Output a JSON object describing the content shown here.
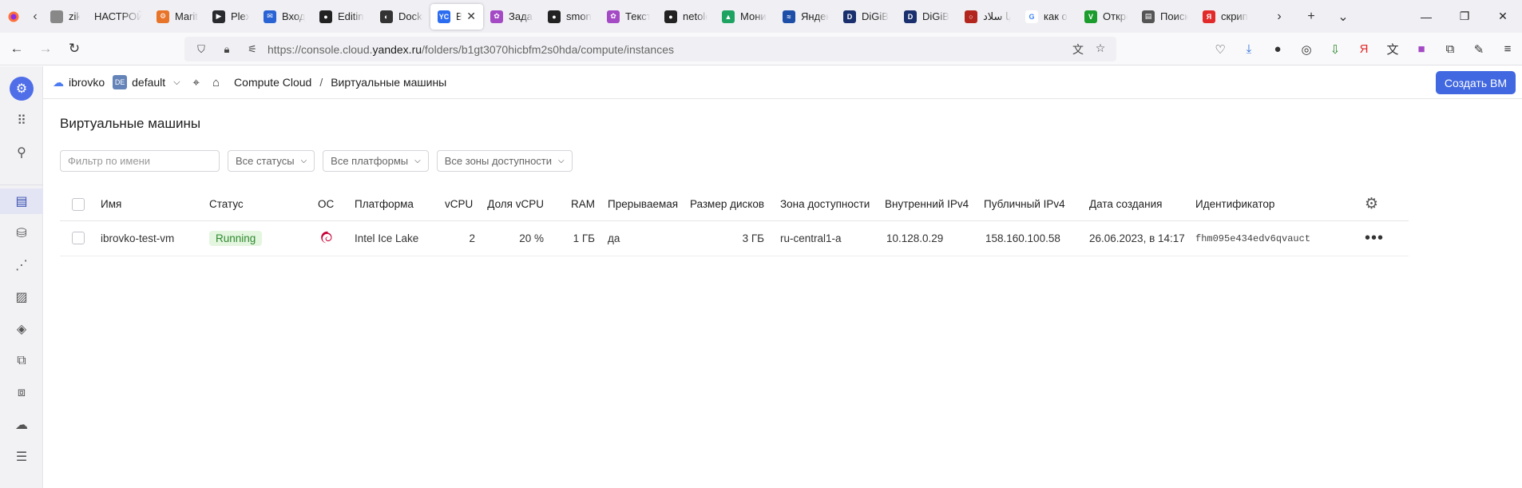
{
  "browser": {
    "tabs": [
      {
        "label": "zik U",
        "fav_color": "#888888",
        "fav_text": ""
      },
      {
        "label": "НАСТРОЙ",
        "fav_color": "",
        "fav_text": ""
      },
      {
        "label": "Mariti",
        "fav_color": "#e8742a",
        "fav_text": "⚙"
      },
      {
        "label": "Plex",
        "fav_color": "#282a2d",
        "fav_text": "▶"
      },
      {
        "label": "Входя",
        "fav_color": "#2a63d4",
        "fav_text": "✉"
      },
      {
        "label": "Editin",
        "fav_color": "#222222",
        "fav_text": "●"
      },
      {
        "label": "Docke",
        "fav_color": "#333333",
        "fav_text": "◐"
      },
      {
        "label": "Вир",
        "fav_color": "#2b6cf0",
        "fav_text": "YC",
        "active": true
      },
      {
        "label": "Задан",
        "fav_color": "#a34ac4",
        "fav_text": "✿"
      },
      {
        "label": "smon",
        "fav_color": "#222222",
        "fav_text": "●"
      },
      {
        "label": "Текст",
        "fav_color": "#a34ac4",
        "fav_text": "✿"
      },
      {
        "label": "netolo",
        "fav_color": "#222222",
        "fav_text": "●"
      },
      {
        "label": "Мони",
        "fav_color": "#1ea362",
        "fav_text": "▲"
      },
      {
        "label": "Яндек",
        "fav_color": "#1d4fa8",
        "fav_text": "≈"
      },
      {
        "label": "DiGiB",
        "fav_color": "#1a2f6e",
        "fav_text": "D"
      },
      {
        "label": "DiGiB",
        "fav_color": "#1a2f6e",
        "fav_text": "D"
      },
      {
        "label": "یا سلاد",
        "fav_color": "#b3261e",
        "fav_text": "○"
      },
      {
        "label": "как о",
        "fav_color": "#ffffff",
        "fav_text": "G"
      },
      {
        "label": "Откро",
        "fav_color": "#1c9c2c",
        "fav_text": "V"
      },
      {
        "label": "Поиск",
        "fav_color": "#555555",
        "fav_text": "▤"
      },
      {
        "label": "скрип",
        "fav_color": "#e22a2a",
        "fav_text": "Я"
      }
    ],
    "url_prefix": "https://console.cloud.",
    "url_domain": "yandex.ru",
    "url_path": "/folders/b1gt3070hicbfm2s0hda/compute/instances"
  },
  "topbar": {
    "cloud_name": "ibrovko",
    "folder_badge": "DE",
    "folder_name": "default",
    "breadcrumb_service": "Compute Cloud",
    "breadcrumb_sep": "/",
    "breadcrumb_current": "Виртуальные машины",
    "create_button": "Создать ВМ"
  },
  "page": {
    "title": "Виртуальные машины",
    "filter_placeholder": "Фильтр по имени",
    "status_select": "Все статусы",
    "platform_select": "Все платформы",
    "zone_select": "Все зоны доступности"
  },
  "table": {
    "headers": {
      "name": "Имя",
      "status": "Статус",
      "os": "ОС",
      "platform": "Платформа",
      "vcpu": "vCPU",
      "core_fraction": "Доля vCPU",
      "ram": "RAM",
      "preemptible": "Прерываемая",
      "disk_size": "Размер дисков",
      "zone": "Зона доступности",
      "internal_ip": "Внутренний IPv4",
      "public_ip": "Публичный IPv4",
      "created": "Дата создания",
      "id": "Идентификатор"
    },
    "rows": [
      {
        "name": "ibrovko-test-vm",
        "status": "Running",
        "os_icon": "debian-icon",
        "platform": "Intel Ice Lake",
        "vcpu": "2",
        "core_fraction": "20 %",
        "ram": "1 ГБ",
        "preemptible": "да",
        "disk_size": "3 ГБ",
        "zone": "ru-central1-a",
        "internal_ip": "10.128.0.29",
        "public_ip": "158.160.100.58",
        "created": "26.06.2023, в 14:17",
        "id": "fhm095e434edv6qvauct"
      }
    ]
  },
  "colors": {
    "accent": "#4168e0",
    "status_running_bg": "#e4f5e0",
    "status_running_fg": "#2d8a2d",
    "debian": "#c70036"
  }
}
